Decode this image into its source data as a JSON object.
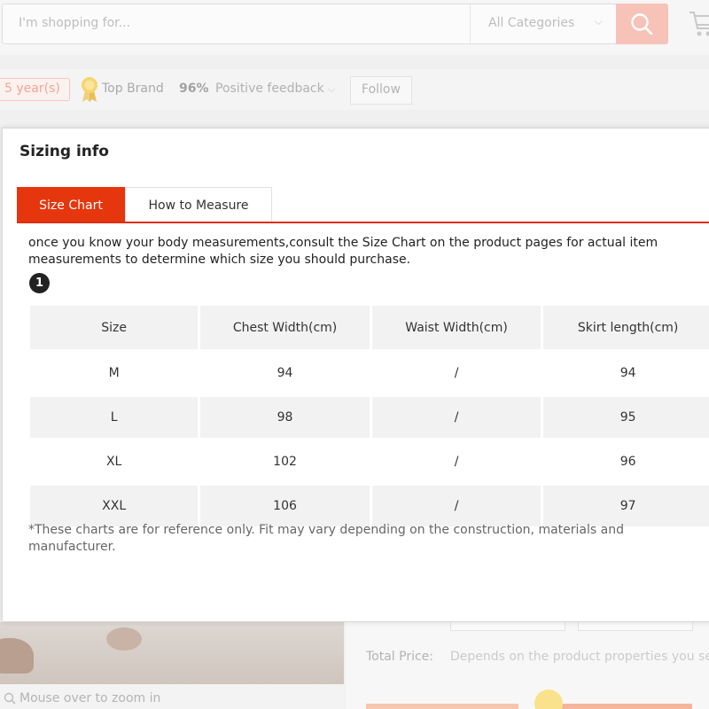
{
  "header": {
    "search_placeholder": "I'm shopping for...",
    "category_label": "All Categories"
  },
  "store": {
    "years_label": "5 year(s)",
    "top_brand_label": "Top Brand",
    "positive_pct": "96%",
    "positive_label": "Positive feedback",
    "follow_label": "Follow"
  },
  "product": {
    "total_price_label": "Total Price:",
    "total_price_value": "Depends on the product properties you se",
    "zoom_hint": "Mouse over to zoom in"
  },
  "modal": {
    "title": "Sizing info",
    "tabs": [
      {
        "label": "Size Chart",
        "active": true
      },
      {
        "label": "How to Measure",
        "active": false
      }
    ],
    "intro": "once you know your body measurements,consult the Size Chart on the product pages for actual item measurements to determine which size you should purchase.",
    "badge": "1",
    "table": {
      "headers": [
        "Size",
        "Chest Width(cm)",
        "Waist Width(cm)",
        "Skirt length(cm)"
      ],
      "rows": [
        [
          "M",
          "94",
          "/",
          "94"
        ],
        [
          "L",
          "98",
          "/",
          "95"
        ],
        [
          "XL",
          "102",
          "/",
          "96"
        ],
        [
          "XXL",
          "106",
          "/",
          "97"
        ]
      ]
    },
    "note": "*These charts are for reference only. Fit may vary depending on the construction, materials and manufacturer."
  },
  "colors": {
    "accent": "#e5360e",
    "accent_soft": "#f7c2b7"
  }
}
